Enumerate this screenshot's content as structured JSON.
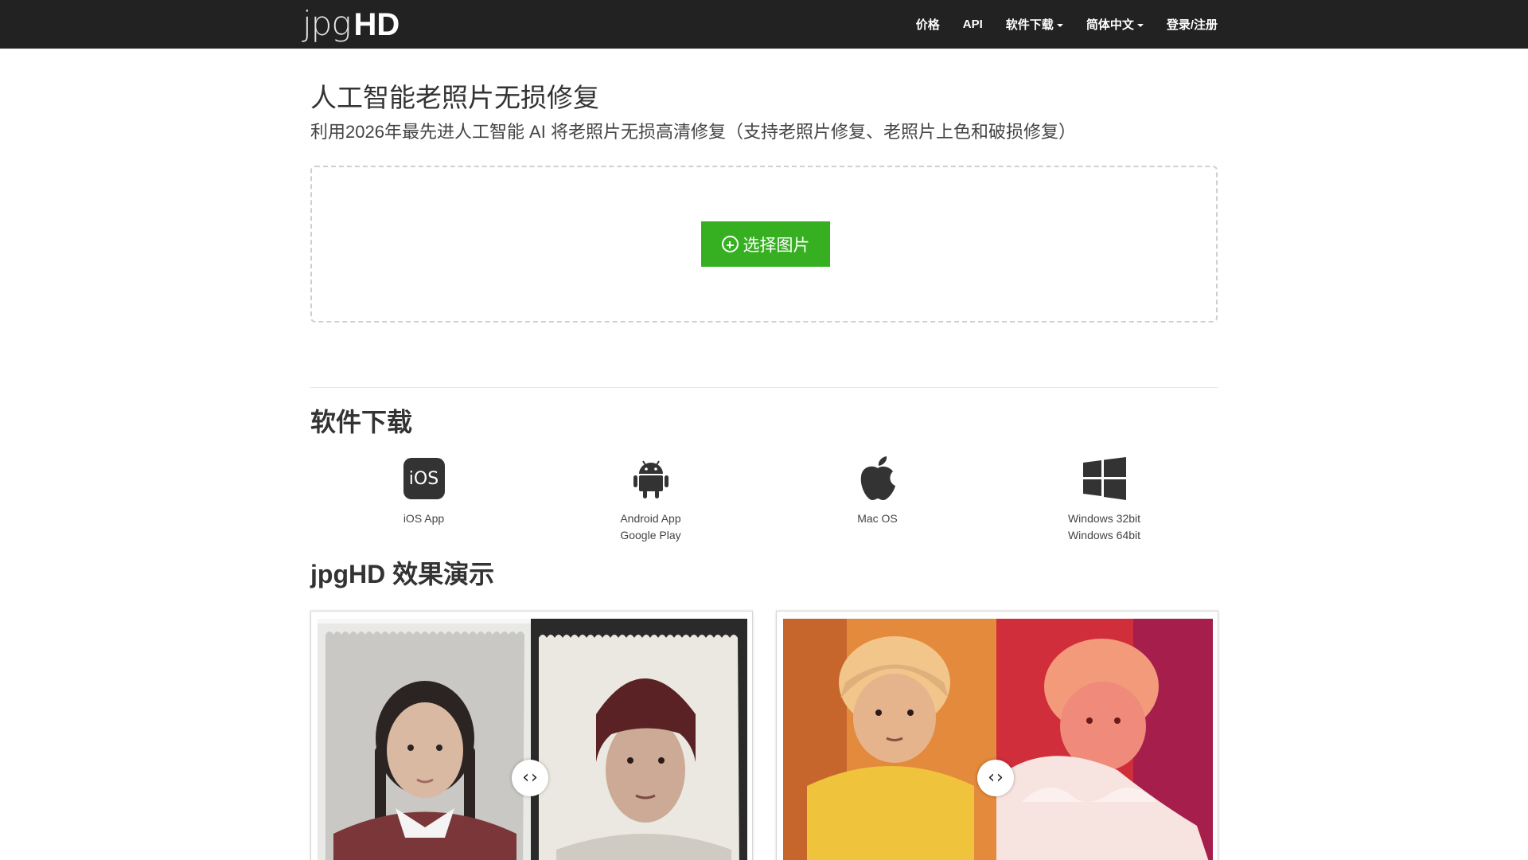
{
  "brand": {
    "thin": "jpg",
    "bold": "HD"
  },
  "nav": {
    "items": [
      {
        "label": "价格",
        "dropdown": false
      },
      {
        "label": "API",
        "dropdown": false
      },
      {
        "label": "软件下载",
        "dropdown": true
      },
      {
        "label": "简体中文",
        "dropdown": true
      },
      {
        "label": "登录/注册",
        "dropdown": false
      }
    ]
  },
  "hero": {
    "title": "人工智能老照片无损修复",
    "subtitle": "利用2026年最先进人工智能 AI 将老照片无损高清修复（支持老照片修复、老照片上色和破损修复）"
  },
  "upload": {
    "button_label": "选择图片",
    "icon": "plus-circle-icon"
  },
  "downloads": {
    "title": "软件下载",
    "items": [
      {
        "icon": "ios-icon",
        "icon_text": "iOS",
        "line1": "iOS App",
        "line2": ""
      },
      {
        "icon": "android-icon",
        "line1": "Android App",
        "line2": "Google Play"
      },
      {
        "icon": "apple-icon",
        "line1": "Mac OS",
        "line2": ""
      },
      {
        "icon": "windows-icon",
        "line1": "Windows 32bit",
        "line2": "Windows 64bit"
      }
    ]
  },
  "demo": {
    "title": "jpgHD 效果演示",
    "handle_left": "‹",
    "handle_right": "›"
  },
  "colors": {
    "navbar_bg": "#222222",
    "primary_button": "#36b021"
  }
}
